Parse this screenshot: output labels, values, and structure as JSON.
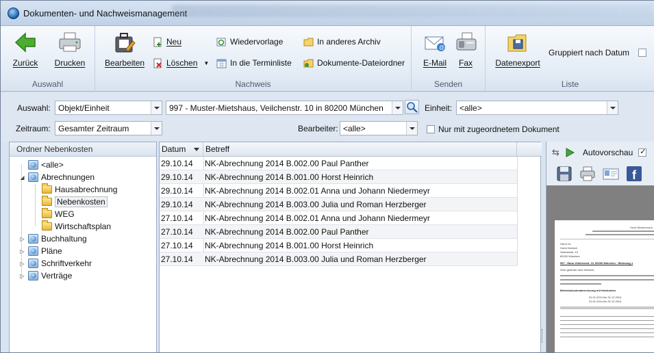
{
  "window": {
    "title": "Dokumenten- und Nachweismanagement"
  },
  "ribbon": {
    "groups": {
      "auswahl": "Auswahl",
      "nachweis": "Nachweis",
      "senden": "Senden",
      "liste": "Liste"
    },
    "zurueck": "Zurück",
    "drucken": "Drucken",
    "bearbeiten": "Bearbeiten",
    "neu": "Neu",
    "loeschen": "Löschen",
    "wiedervorlage": "Wiedervorlage",
    "terminliste": "In die Terminliste",
    "anderes_archiv": "In anderes Archiv",
    "dateiordner": "Dokumente-Dateiordner",
    "email": "E-Mail",
    "fax": "Fax",
    "datenexport": "Datenexport",
    "gruppiert": "Gruppiert nach Datum"
  },
  "filter": {
    "auswahl_label": "Auswahl:",
    "auswahl_value": "Objekt/Einheit",
    "objekt_value": "997 - Muster-Mietshaus, Veilchenstr. 10 in 80200 München",
    "einheit_label": "Einheit:",
    "einheit_value": "<alle>",
    "zeitraum_label": "Zeitraum:",
    "zeitraum_value": "Gesamter Zeitraum",
    "bearbeiter_label": "Bearbeiter:",
    "bearbeiter_value": "<alle>",
    "nur_zugeordnet": "Nur mit zugeordnetem Dokument"
  },
  "tree": {
    "header": "Ordner Nebenkosten",
    "items": [
      "<alle>",
      "Abrechnungen",
      "Hausabrechnung",
      "Nebenkosten",
      "WEG",
      "Wirtschaftsplan",
      "Buchhaltung",
      "Pläne",
      "Schriftverkehr",
      "Verträge"
    ]
  },
  "grid": {
    "col_datum": "Datum",
    "col_betreff": "Betreff",
    "rows": [
      {
        "datum": "29.10.14",
        "betreff": "NK-Abrechnung 2014 B.002.00 Paul Panther"
      },
      {
        "datum": "29.10.14",
        "betreff": "NK-Abrechnung 2014 B.001.00 Horst Heinrich"
      },
      {
        "datum": "29.10.14",
        "betreff": "NK-Abrechnung 2014 B.002.01 Anna und Johann Niedermeyr"
      },
      {
        "datum": "29.10.14",
        "betreff": "NK-Abrechnung 2014 B.003.00 Julia und  Roman Herzberger"
      },
      {
        "datum": "27.10.14",
        "betreff": "NK-Abrechnung 2014 B.002.01 Anna und Johann Niedermeyr"
      },
      {
        "datum": "27.10.14",
        "betreff": "NK-Abrechnung 2014 B.002.00 Paul Panther"
      },
      {
        "datum": "27.10.14",
        "betreff": "NK-Abrechnung 2014 B.001.00 Horst Heinrich"
      },
      {
        "datum": "27.10.14",
        "betreff": "NK-Abrechnung 2014 B.003.00 Julia und  Roman Herzberger"
      }
    ]
  },
  "preview": {
    "autovorschau": "Autovorschau",
    "doc": {
      "sender": "Horst Mustermann",
      "recipient": [
        "Herrn Dr.",
        "Horst Heinrich",
        "Veilchenstr. 10",
        "80200 München"
      ],
      "subject": "997 - Haus Veilchenstr. 10, 80200 München · Wohnung 1",
      "greeting": "Sehr geehrter Herr Heinrich,",
      "section": "Betriebskostenabrechnung mit Heizkosten",
      "period1": "01.01.2014  bis  31.12.2014",
      "period2": "01.01.2014  bis  31.12.2014"
    }
  },
  "colors": {
    "accent": "#1c5fa8",
    "ribbon": "#e4ecf6",
    "selection": "#eef1f5"
  }
}
